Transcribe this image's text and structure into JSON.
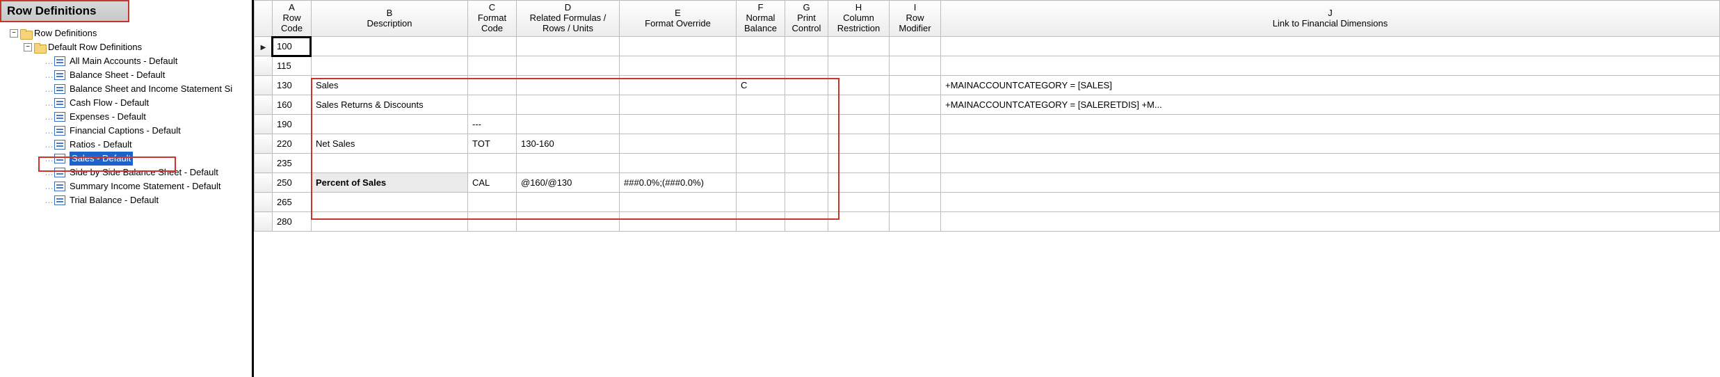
{
  "panel": {
    "title": "Row Definitions",
    "root": "Row Definitions",
    "group": "Default Row Definitions",
    "items": [
      "All Main Accounts - Default",
      "Balance Sheet - Default",
      "Balance Sheet and Income Statement Si",
      "Cash Flow - Default",
      "Expenses - Default",
      "Financial Captions - Default",
      "Ratios - Default",
      "Sales - Default",
      "Side by Side Balance Sheet - Default",
      "Summary Income Statement - Default",
      "Trial Balance - Default"
    ],
    "selected_index": 7
  },
  "grid": {
    "columns": [
      {
        "letter": "A",
        "label": "Row\nCode"
      },
      {
        "letter": "B",
        "label": "Description"
      },
      {
        "letter": "C",
        "label": "Format\nCode"
      },
      {
        "letter": "D",
        "label": "Related Formulas /\nRows / Units"
      },
      {
        "letter": "E",
        "label": "Format Override"
      },
      {
        "letter": "F",
        "label": "Normal\nBalance"
      },
      {
        "letter": "G",
        "label": "Print\nControl"
      },
      {
        "letter": "H",
        "label": "Column\nRestriction"
      },
      {
        "letter": "I",
        "label": "Row\nModifier"
      },
      {
        "letter": "J",
        "label": "Link to Financial Dimensions"
      }
    ],
    "rows": [
      {
        "active": true,
        "A": "100",
        "B": "",
        "C": "",
        "D": "",
        "E": "",
        "F": "",
        "G": "",
        "H": "",
        "I": "",
        "J": ""
      },
      {
        "A": "115",
        "B": "",
        "C": "",
        "D": "",
        "E": "",
        "F": "",
        "G": "",
        "H": "",
        "I": "",
        "J": ""
      },
      {
        "A": "130",
        "B": "Sales",
        "C": "",
        "D": "",
        "E": "",
        "F": "C",
        "G": "",
        "H": "",
        "I": "",
        "J": "+MAINACCOUNTCATEGORY = [SALES]"
      },
      {
        "A": "160",
        "B": "Sales Returns & Discounts",
        "C": "",
        "D": "",
        "E": "",
        "F": "",
        "G": "",
        "H": "",
        "I": "",
        "J": "+MAINACCOUNTCATEGORY = [SALERETDIS] +M..."
      },
      {
        "A": "190",
        "B": "",
        "C": "---",
        "D": "",
        "E": "",
        "F": "",
        "G": "",
        "H": "",
        "I": "",
        "J": ""
      },
      {
        "A": "220",
        "B": "Net Sales",
        "C": "TOT",
        "D": "130-160",
        "E": "",
        "F": "",
        "G": "",
        "H": "",
        "I": "",
        "J": ""
      },
      {
        "A": "235",
        "B": "",
        "C": "",
        "D": "",
        "E": "",
        "F": "",
        "G": "",
        "H": "",
        "I": "",
        "J": ""
      },
      {
        "A": "250",
        "B": "Percent of Sales",
        "C": "CAL",
        "D": "@160/@130",
        "E": "###0.0%;(###0.0%)",
        "F": "",
        "G": "",
        "H": "",
        "I": "",
        "J": "",
        "bold": true,
        "hl": true
      },
      {
        "A": "265",
        "B": "",
        "C": "",
        "D": "",
        "E": "",
        "F": "",
        "G": "",
        "H": "",
        "I": "",
        "J": ""
      },
      {
        "A": "280",
        "B": "",
        "C": "",
        "D": "",
        "E": "",
        "F": "",
        "G": "",
        "H": "",
        "I": "",
        "J": ""
      }
    ]
  }
}
